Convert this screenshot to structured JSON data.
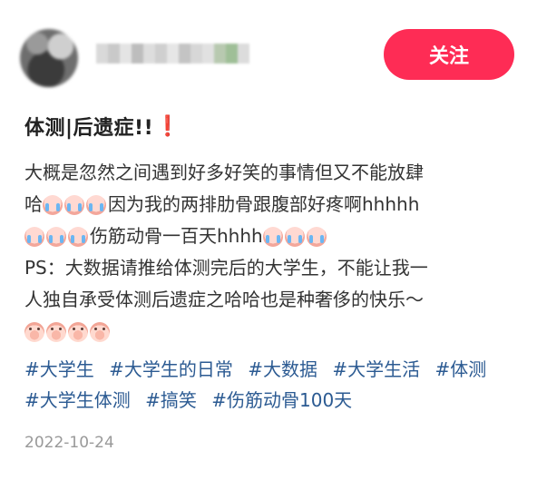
{
  "follow_button": "关注",
  "post": {
    "title": "体测|后遗症‼️",
    "title_text": "体测|后遗症!!",
    "title_emoji": "❗",
    "body_line_1": "大概是忽然之间遇到好多好笑的事情但又不能放肆",
    "body_line_2_prefix": "哈",
    "body_line_2_suffix": "因为我的两排肋骨跟腹部好疼啊hhhhh",
    "body_line_3_text": "伤筋动骨一百天hhhh",
    "body_line_4": "PS：大数据请推给体测完后的大学生，不能让我一",
    "body_line_5": "人独自承受体测后遗症之哈哈也是种奢侈的快乐～",
    "emoji_cry": "cry-emoji",
    "emoji_pig": "pig-emoji",
    "tags": [
      "#大学生",
      "#大学生的日常",
      "#大数据",
      "#大学生活",
      "#体测",
      "#大学生体测",
      "#搞笑",
      "#伤筋动骨100天"
    ],
    "date": "2022-10-24"
  },
  "colors": {
    "follow_bg": "#fe2c55",
    "tag": "#2b5a92",
    "date": "#999999"
  }
}
